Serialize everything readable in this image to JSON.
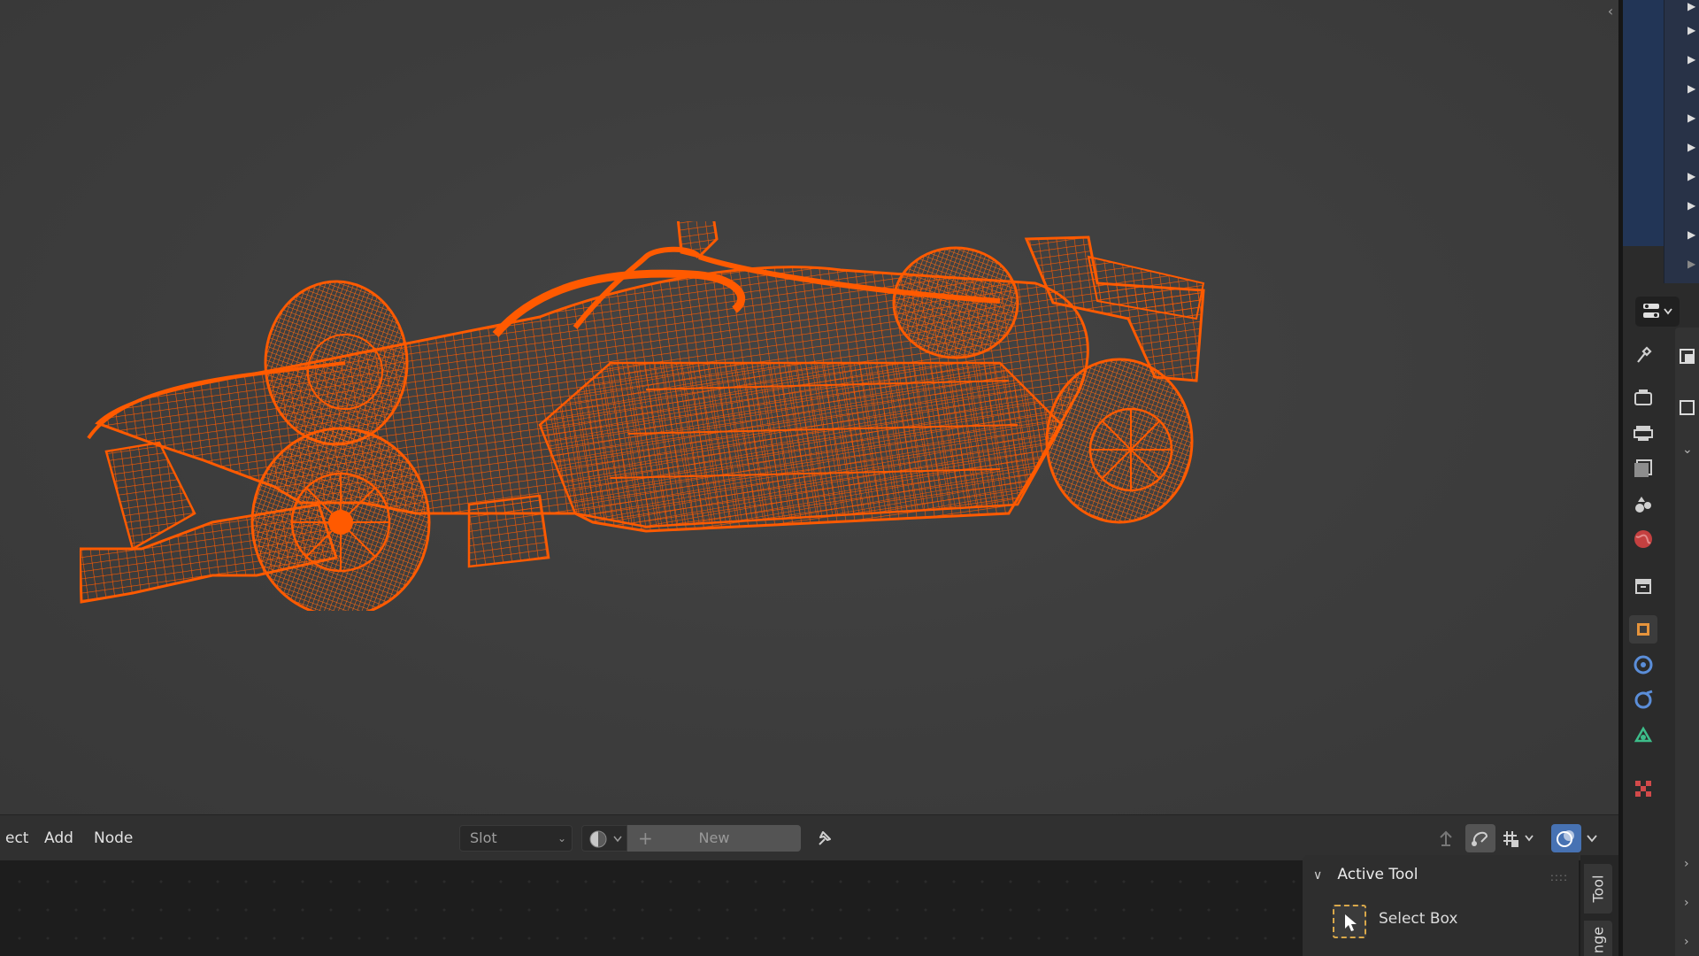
{
  "header": {
    "menus": [
      "ect",
      "Add",
      "Node"
    ],
    "slot_label": "Slot",
    "new_label": "New"
  },
  "npanel": {
    "section_title": "Active Tool",
    "tool_name": "Select Box",
    "tabs": [
      "Tool",
      "nge"
    ]
  },
  "colors": {
    "wireframe": "#ff5a00",
    "viewport_bg": "#3d3d3d",
    "outliner_selection": "#223556",
    "tool_outline": "#d9a84a"
  },
  "icons": {
    "viewport_collapse": "chevron-left-icon",
    "pin": "pin-icon",
    "shading": "material-sphere-icon",
    "add": "plus-icon",
    "select_box": "select-box-icon"
  }
}
